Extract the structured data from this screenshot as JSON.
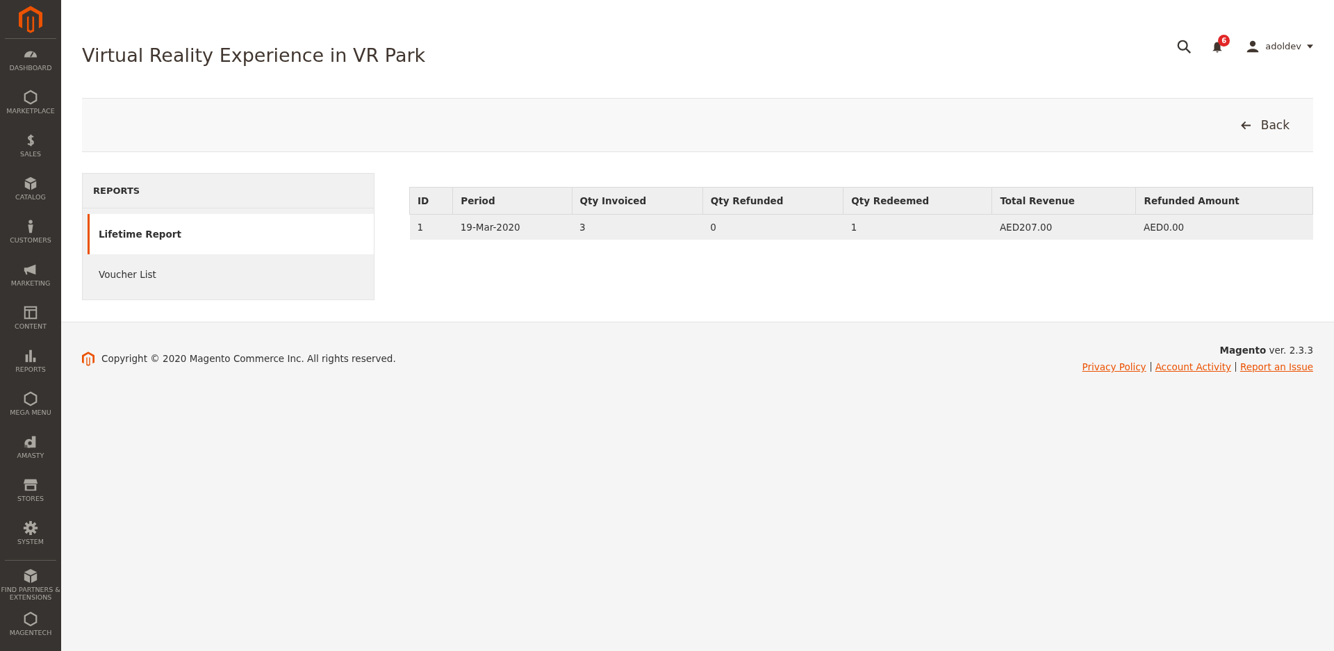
{
  "sidebar": {
    "items": [
      {
        "label": "DASHBOARD",
        "kind": "gauge"
      },
      {
        "label": "MARKETPLACE",
        "kind": "hexagon"
      },
      {
        "label": "SALES",
        "kind": "dollar"
      },
      {
        "label": "CATALOG",
        "kind": "box"
      },
      {
        "label": "CUSTOMERS",
        "kind": "person"
      },
      {
        "label": "MARKETING",
        "kind": "megaphone"
      },
      {
        "label": "CONTENT",
        "kind": "layout"
      },
      {
        "label": "REPORTS",
        "kind": "bars"
      },
      {
        "label": "MEGA MENU",
        "kind": "hexagon"
      },
      {
        "label": "AMASTY",
        "kind": "letter"
      },
      {
        "label": "STORES",
        "kind": "store"
      },
      {
        "label": "SYSTEM",
        "kind": "gear"
      },
      {
        "label": "FIND PARTNERS & EXTENSIONS",
        "kind": "blocks"
      },
      {
        "label": "MAGENTECH",
        "kind": "hexagon"
      }
    ]
  },
  "page_title": "Virtual Reality Experience in VR Park",
  "header": {
    "notifications_count": "6",
    "user": "adoldev"
  },
  "actions": {
    "back": "Back"
  },
  "tabs": {
    "title": "REPORTS",
    "items": [
      {
        "label": "Lifetime Report",
        "selected": true
      },
      {
        "label": "Voucher List",
        "selected": false
      }
    ]
  },
  "table": {
    "columns": [
      "ID",
      "Period",
      "Qty Invoiced",
      "Qty Refunded",
      "Qty Redeemed",
      "Total Revenue",
      "Refunded Amount"
    ],
    "rows": [
      [
        "1",
        "19-Mar-2020",
        "3",
        "0",
        "1",
        "AED207.00",
        "AED0.00"
      ]
    ]
  },
  "footer": {
    "copyright": "Copyright © 2020 Magento Commerce Inc. All rights reserved.",
    "version": "**Magento** ver. 2.3.3",
    "links": [
      "Privacy Policy",
      "Account Activity",
      "Report an Issue"
    ]
  }
}
